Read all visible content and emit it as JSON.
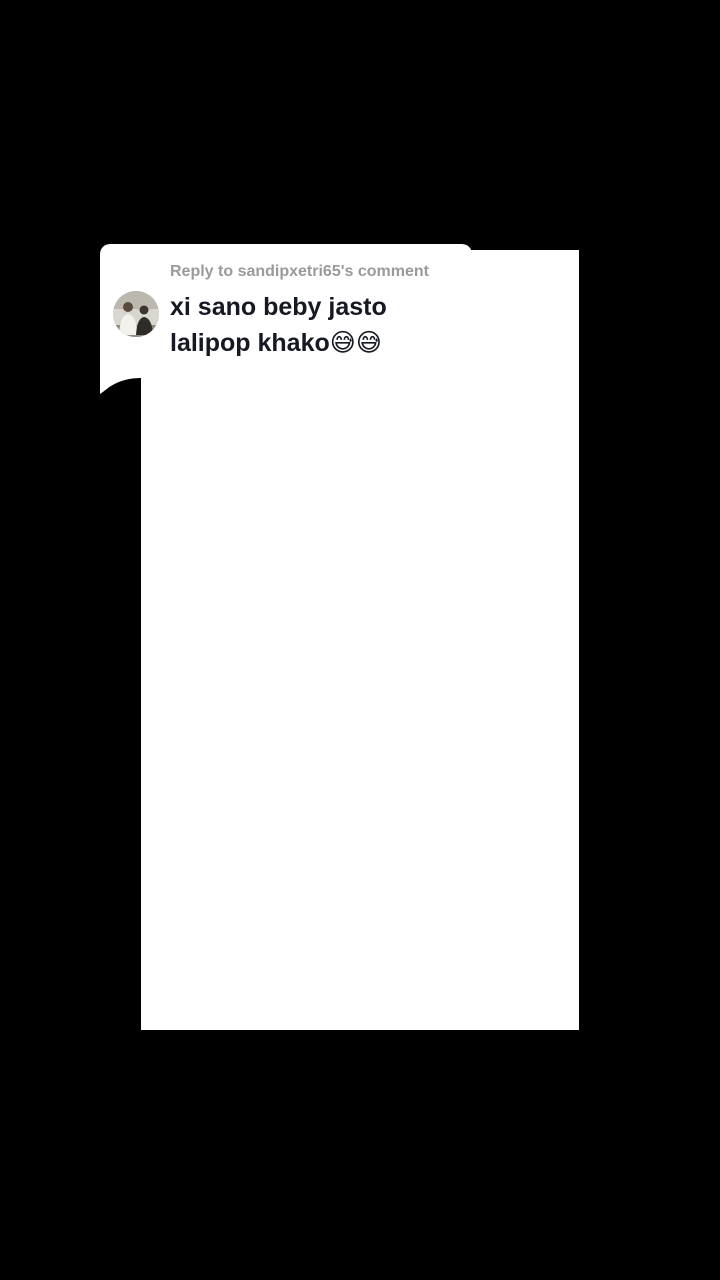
{
  "reply_sticker": {
    "header": "Reply to sandipxetri65's comment",
    "comment_line1": "xi sano beby jasto",
    "comment_line2": "lalipop khako",
    "comment_emojis": "😅😅",
    "avatar_icon": "user-photo-avatar"
  },
  "colors": {
    "background": "#000000",
    "video_frame": "#ffffff",
    "header_text": "#9a9a9a",
    "comment_text": "#161823"
  }
}
